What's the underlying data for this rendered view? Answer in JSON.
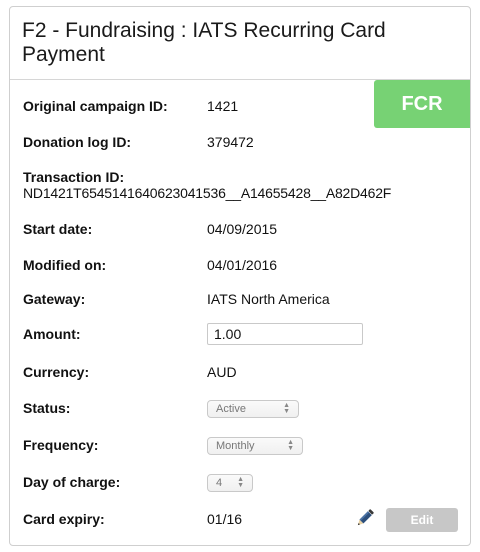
{
  "title": "F2 - Fundraising : IATS Recurring Card Payment",
  "badge": "FCR",
  "fields": {
    "original_campaign_id": {
      "label": "Original campaign ID:",
      "value": "1421"
    },
    "donation_log_id": {
      "label": "Donation log ID:",
      "value": "379472"
    },
    "transaction_id": {
      "label": "Transaction ID:",
      "value": "ND1421T6545141640623041536__A14655428__A82D462F"
    },
    "start_date": {
      "label": "Start date:",
      "value": "04/09/2015"
    },
    "modified_on": {
      "label": "Modified on:",
      "value": "04/01/2016"
    },
    "gateway": {
      "label": "Gateway:",
      "value": "IATS North America"
    },
    "amount": {
      "label": "Amount:",
      "value": "1.00"
    },
    "currency": {
      "label": "Currency:",
      "value": "AUD"
    },
    "status": {
      "label": "Status:",
      "value": "Active"
    },
    "frequency": {
      "label": "Frequency:",
      "value": "Monthly"
    },
    "day_of_charge": {
      "label": "Day of charge:",
      "value": "4"
    },
    "card_expiry": {
      "label": "Card expiry:",
      "value": "01/16"
    }
  },
  "actions": {
    "edit_label": "Edit",
    "edit_icon": "pencil-icon"
  },
  "colors": {
    "badge_bg": "#77d274",
    "edit_button_bg": "#c7c7c7",
    "pencil": "#2c4f7c"
  }
}
